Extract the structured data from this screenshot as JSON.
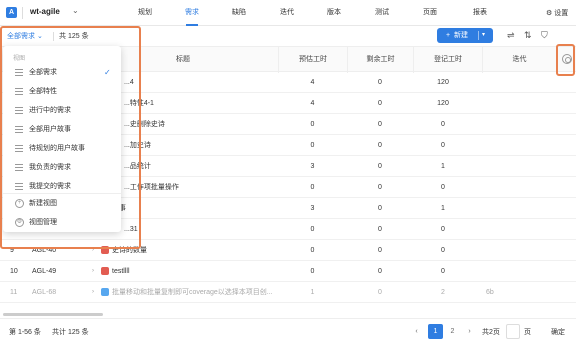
{
  "header": {
    "logo": "A",
    "project": "wt-agile",
    "nav": [
      "规划",
      "需求",
      "缺陷",
      "迭代",
      "版本",
      "测试",
      "页面",
      "报表"
    ],
    "active_nav": 1,
    "settings_label": "设置"
  },
  "toolbar": {
    "view_label": "全部需求",
    "total_label": "共 125 条",
    "new_button": "新建"
  },
  "table": {
    "columns": [
      "标题",
      "预估工时",
      "剩余工时",
      "登记工时",
      "迭代"
    ],
    "rows": [
      {
        "id": "",
        "key": "",
        "title": "...4",
        "est": "4",
        "rem": "0",
        "reg": "120",
        "iter": "",
        "badge": ""
      },
      {
        "id": "",
        "key": "",
        "title": "...特性4-1",
        "est": "4",
        "rem": "0",
        "reg": "120",
        "iter": "",
        "badge": ""
      },
      {
        "id": "",
        "key": "",
        "title": "...史删除史诗",
        "est": "0",
        "rem": "0",
        "reg": "0",
        "iter": "",
        "badge": ""
      },
      {
        "id": "",
        "key": "",
        "title": "...加史诗",
        "est": "0",
        "rem": "0",
        "reg": "0",
        "iter": "",
        "badge": ""
      },
      {
        "id": "",
        "key": "",
        "title": "...品统计",
        "est": "3",
        "rem": "0",
        "reg": "1",
        "iter": "",
        "badge": ""
      },
      {
        "id": "",
        "key": "",
        "title": "...工作项批量操作",
        "est": "0",
        "rem": "0",
        "reg": "0",
        "iter": "",
        "badge": ""
      },
      {
        "id": "",
        "key": "",
        "title": "故事",
        "est": "3",
        "rem": "0",
        "reg": "1",
        "iter": "",
        "badge": "blue"
      },
      {
        "id": "",
        "key": "",
        "title": "...31",
        "est": "0",
        "rem": "0",
        "reg": "0",
        "iter": "",
        "badge": ""
      },
      {
        "id": "9",
        "key": "AGL-40",
        "title": "史诗的数量",
        "est": "0",
        "rem": "0",
        "reg": "0",
        "iter": "",
        "badge": "red"
      },
      {
        "id": "10",
        "key": "AGL-49",
        "title": "testllll",
        "est": "0",
        "rem": "0",
        "reg": "0",
        "iter": "",
        "badge": "red"
      },
      {
        "id": "11",
        "key": "AGL-68",
        "title": "批量移动和批量复制即可coverage以选择本项目创...",
        "est": "1",
        "rem": "0",
        "reg": "2",
        "iter": "6b",
        "badge": "blue"
      }
    ]
  },
  "dropdown": {
    "heading": "视图",
    "items": [
      "全部需求",
      "全部特性",
      "进行中的需求",
      "全部用户故事",
      "待规划的用户故事",
      "我负责的需求",
      "我提交的需求"
    ],
    "checked": 0,
    "actions": [
      "新建视图",
      "视图管理"
    ]
  },
  "footer": {
    "range": "第 1-56 条",
    "total": "共计 125 条",
    "pages": [
      "1",
      "2"
    ],
    "page_total": "共2页",
    "confirm": "确定"
  },
  "colors": {
    "accent": "#2f7de1",
    "highlight": "#e8804e"
  }
}
